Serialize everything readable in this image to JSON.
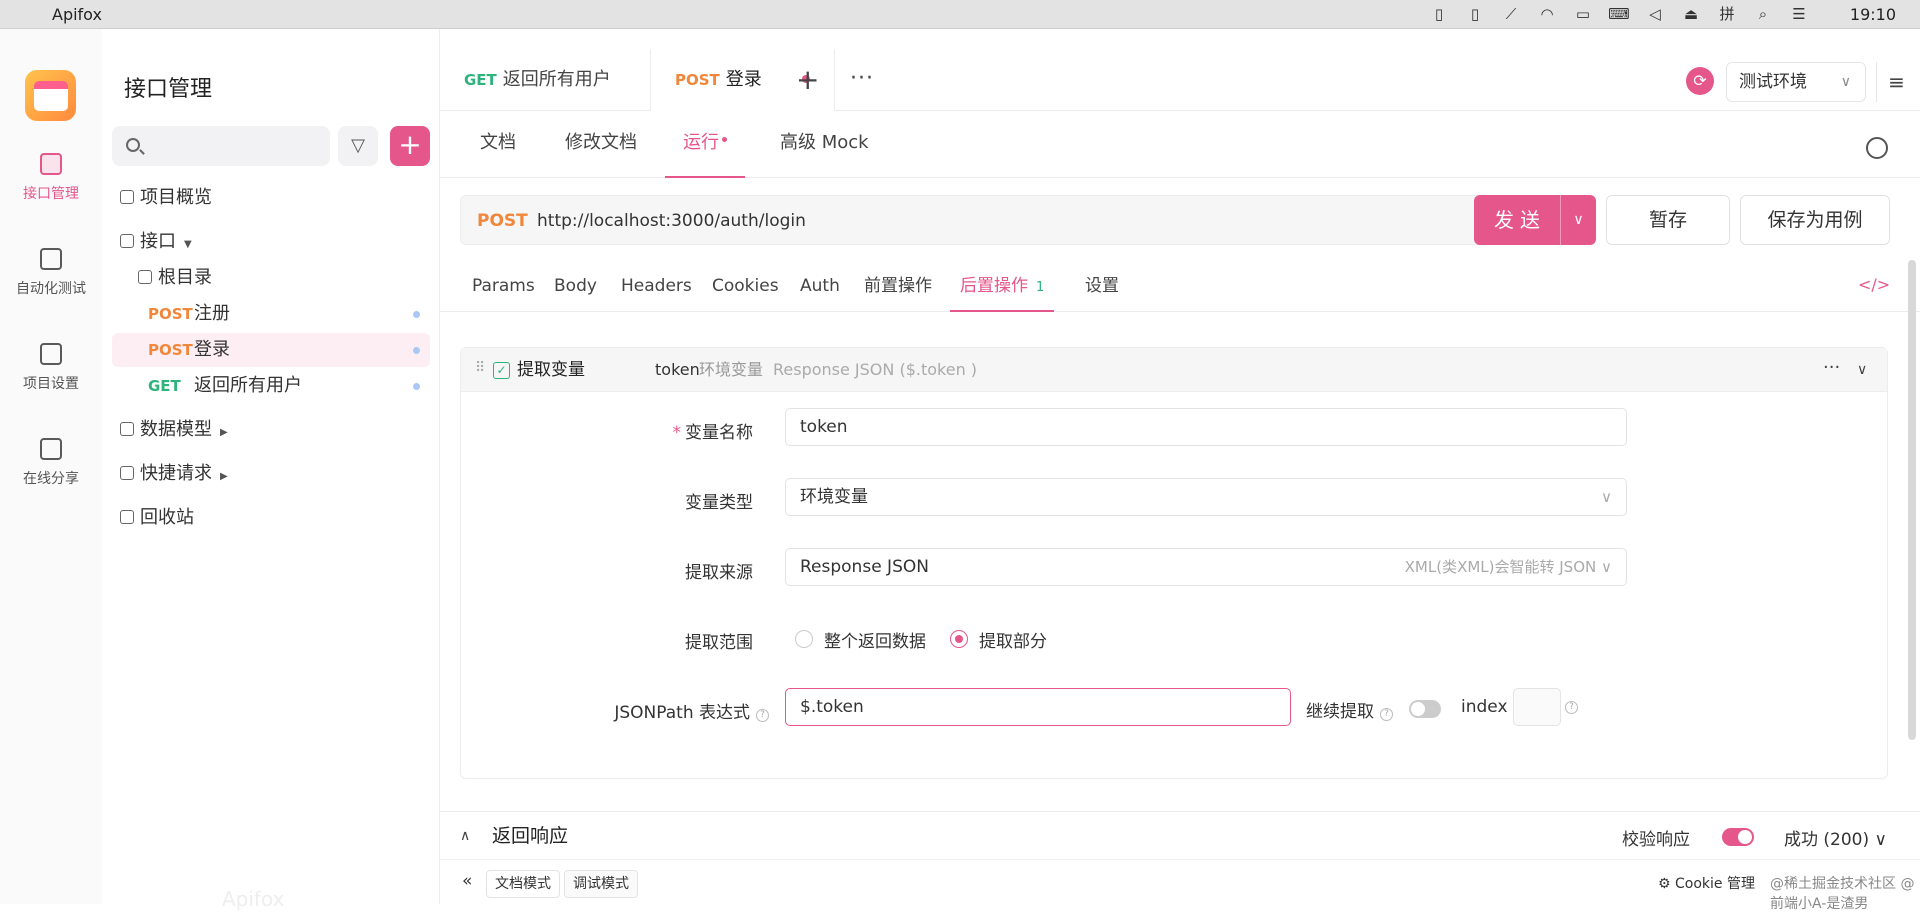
{
  "menubar": {
    "app_name": "Apifox",
    "time": "19:10"
  },
  "rail": {
    "items": [
      {
        "label": "接口管理"
      },
      {
        "label": "自动化测试"
      },
      {
        "label": "项目设置"
      },
      {
        "label": "在线分享"
      }
    ]
  },
  "sidebar": {
    "title": "接口管理",
    "search_placeholder": "",
    "tree": {
      "overview": "项目概览",
      "apis": "接口",
      "root": "根目录",
      "endpoints": [
        {
          "method": "POST",
          "name": "注册"
        },
        {
          "method": "POST",
          "name": "登录"
        },
        {
          "method": "GET",
          "name": "返回所有用户"
        }
      ],
      "models": "数据模型",
      "quick": "快捷请求",
      "trash": "回收站"
    },
    "watermark": "Apifox"
  },
  "tabs": [
    {
      "method": "GET",
      "label": "返回所有用户"
    },
    {
      "method": "POST",
      "label": "登录"
    }
  ],
  "env": {
    "selected": "测试环境"
  },
  "subtabs": [
    "文档",
    "修改文档",
    "运行",
    "高级 Mock"
  ],
  "request": {
    "method": "POST",
    "url": "http://localhost:3000/auth/login",
    "send_label": "发送",
    "save_label": "暂存",
    "save_case_label": "保存为用例"
  },
  "request_tabs": [
    {
      "label": "Params"
    },
    {
      "label": "Body"
    },
    {
      "label": "Headers"
    },
    {
      "label": "Cookies"
    },
    {
      "label": "Auth"
    },
    {
      "label": "前置操作"
    },
    {
      "label": "后置操作",
      "count": "1"
    },
    {
      "label": "设置"
    }
  ],
  "extract": {
    "title": "提取变量",
    "summary_var": "token",
    "summary_type": "环境变量",
    "summary_source": "Response JSON ($.token )",
    "labels": {
      "var_name": "变量名称",
      "var_type": "变量类型",
      "source": "提取来源",
      "scope": "提取范围",
      "jsonpath": "JSONPath 表达式",
      "continue": "继续提取",
      "index": "index"
    },
    "var_name": "token",
    "var_type": "环境变量",
    "source": "Response JSON",
    "source_hint": "XML(类XML)会智能转 JSON",
    "scope_options": [
      "整个返回数据",
      "提取部分"
    ],
    "scope_selected": 1,
    "jsonpath": "$.token",
    "continue_on": false
  },
  "response": {
    "title": "返回响应",
    "validate_label": "校验响应",
    "validate_on": true,
    "status": "成功 (200)"
  },
  "statusbar": {
    "modes": [
      "文档模式",
      "调试模式"
    ],
    "cookie_label": "Cookie 管理",
    "credit": "@稀土掘金技术社区 @前端小A-是渣男"
  }
}
